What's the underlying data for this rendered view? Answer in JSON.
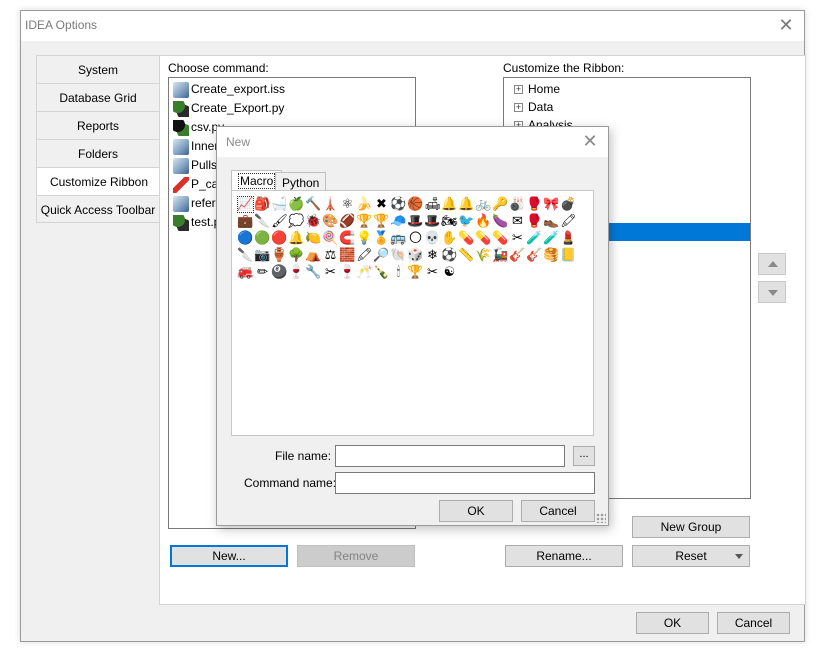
{
  "window": {
    "title": "IDEA Options",
    "close_glyph": "✕"
  },
  "tabs": [
    {
      "label": "System"
    },
    {
      "label": "Database Grid"
    },
    {
      "label": "Reports"
    },
    {
      "label": "Folders"
    },
    {
      "label": "Customize Ribbon"
    },
    {
      "label": "Quick Access Toolbar"
    }
  ],
  "left": {
    "label": "Choose command:",
    "commands": [
      {
        "label": "Create_export.iss",
        "icon": "macro-icon"
      },
      {
        "label": "Create_Export.py",
        "icon": "python-icon"
      },
      {
        "label": "csv.py",
        "icon": "python-icon"
      },
      {
        "label": "Innerj",
        "icon": "macro-icon"
      },
      {
        "label": "Pulls_",
        "icon": "macro-icon"
      },
      {
        "label": "P_ca",
        "icon": "red-script-icon"
      },
      {
        "label": "refere",
        "icon": "macro-icon"
      },
      {
        "label": "test.p",
        "icon": "python-icon"
      }
    ],
    "new_button": "New...",
    "remove_button": "Remove"
  },
  "right": {
    "label": "Customize the Ribbon:",
    "tree": [
      {
        "label": "Home",
        "expander": "⊞"
      },
      {
        "label": "Data",
        "expander": "⊞"
      },
      {
        "label": "Analysis",
        "expander": "⊞"
      }
    ],
    "new_group_button": "New Group",
    "rename_button": "Rename...",
    "reset_button": "Reset"
  },
  "footer": {
    "ok": "OK",
    "cancel": "Cancel"
  },
  "dialog": {
    "title": "New",
    "close_glyph": "✕",
    "tabs": [
      {
        "label": "Macro"
      },
      {
        "label": "Python"
      }
    ],
    "icons": [
      "📈",
      "🎒",
      "🛁",
      "🍏",
      "🔨",
      "🗼",
      "⚛",
      "🍌",
      "✖",
      "⚽",
      "🏀",
      "🛋",
      "🔔",
      "🔔",
      "🚲",
      "🔑",
      "🎳",
      "🥊",
      "🎀",
      "💣",
      "💼",
      "🔪",
      "🖌",
      "💭",
      "🐞",
      "🎨",
      "🏈",
      "🏆",
      "🏆",
      "🧢",
      "🎩",
      "🎩",
      "🏍",
      "🐦",
      "🔥",
      "🍆",
      "✉",
      "🥊",
      "👞",
      "🖍",
      "🔵",
      "🟢",
      "🔴",
      "🔔",
      "🍋",
      "🍭",
      "🧲",
      "💡",
      "🏅",
      "🚌",
      "🌕",
      "💀",
      "✋",
      "💊",
      "💊",
      "💊",
      "✂",
      "🧪",
      "🧪",
      "💄",
      "🔪",
      "📷",
      "🏺",
      "🌳",
      "⛺",
      "⚖",
      "🧱",
      "🖍",
      "🔎",
      "🐚",
      "🎲",
      "❄",
      "⚽",
      "📏",
      "🌾",
      "🚂",
      "🎸",
      "🎸",
      "🥞",
      "📒",
      "🚒",
      "✏",
      "🎱",
      "🍷",
      "🔧",
      "✂",
      "🍷",
      "🥂",
      "🍾",
      "🕯",
      "🏆",
      "✂",
      "☯"
    ],
    "file_name_label": "File name:",
    "file_name_value": "",
    "browse_label": "...",
    "command_name_label": "Command name:",
    "command_name_value": "",
    "ok": "OK",
    "cancel": "Cancel"
  }
}
